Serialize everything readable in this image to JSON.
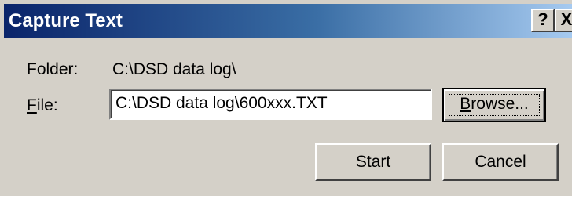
{
  "window": {
    "title": "Capture Text",
    "help_button": "?",
    "close_button": "X"
  },
  "form": {
    "folder_label": "Folder:",
    "folder_value": "C:\\DSD data log\\",
    "file_label_mnemonic": "F",
    "file_label_rest": "ile:",
    "file_value": "C:\\DSD data log\\600xxx.TXT"
  },
  "buttons": {
    "browse_mnemonic": "B",
    "browse_rest": "rowse...",
    "start": "Start",
    "cancel": "Cancel"
  },
  "colors": {
    "face": "#d4d0c8",
    "title_start": "#0a246a",
    "title_end": "#a6caf0"
  }
}
